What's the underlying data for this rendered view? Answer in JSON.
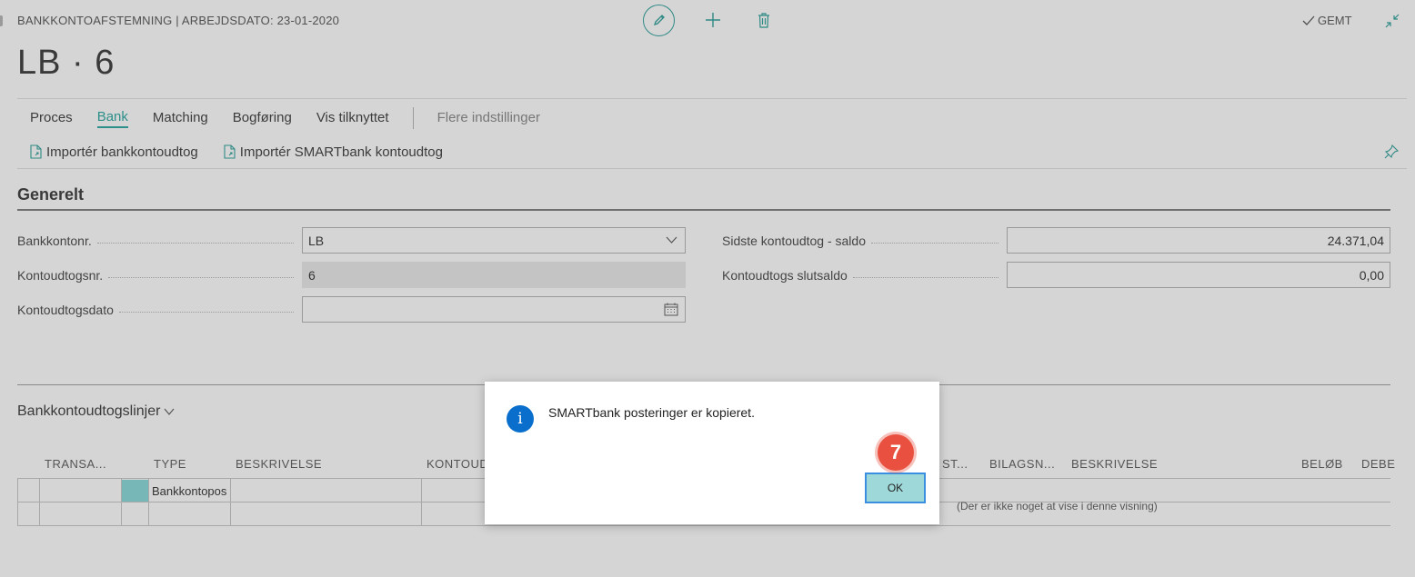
{
  "header": {
    "breadcrumb": "BANKKONTOAFSTEMNING | ARBEJDSDATO: 23-01-2020",
    "saved_label": "GEMT",
    "page_title": "LB · 6"
  },
  "tabs": {
    "proces": "Proces",
    "bank": "Bank",
    "matching": "Matching",
    "bogforing": "Bogføring",
    "vis_tilknyttet": "Vis tilknyttet",
    "flere": "Flere indstillinger"
  },
  "actions": {
    "import_bank": "Importér bankkontoudtog",
    "import_smartbank": "Importér SMARTbank kontoudtog"
  },
  "section": {
    "title": "Generelt"
  },
  "fields": {
    "bankkontonr_label": "Bankkontonr.",
    "bankkontonr_value": "LB",
    "kontoudtogsnr_label": "Kontoudtogsnr.",
    "kontoudtogsnr_value": "6",
    "kontoudtogsdato_label": "Kontoudtogsdato",
    "kontoudtogsdato_value": "",
    "sidste_saldo_label": "Sidste kontoudtog - saldo",
    "sidste_saldo_value": "24.371,04",
    "slutsaldo_label": "Kontoudtogs slutsaldo",
    "slutsaldo_value": "0,00"
  },
  "lines": {
    "title": "Bankkontoudtogslinjer",
    "columns": {
      "transa": "TRANSA...",
      "type": "TYPE",
      "beskrivelse": "BESKRIVELSE",
      "kontoud": "KONTOUDT",
      "st": "ST...",
      "bilagsn": "BILAGSN...",
      "beskrivelse2": "BESKRIVELSE",
      "belob": "BELØB",
      "debe": "DEBE"
    },
    "row_type": "Bankkontopos",
    "empty_message": "(Der er ikke noget at vise i denne visning)"
  },
  "dialog": {
    "message": "SMARTbank posteringer er kopieret.",
    "ok_label": "OK",
    "info_glyph": "i",
    "step_number": "7"
  },
  "colors": {
    "accent": "#2c8f89",
    "info_blue": "#0a6ecc",
    "badge_red": "#e9503f",
    "ok_bg": "#9fd8d8"
  }
}
